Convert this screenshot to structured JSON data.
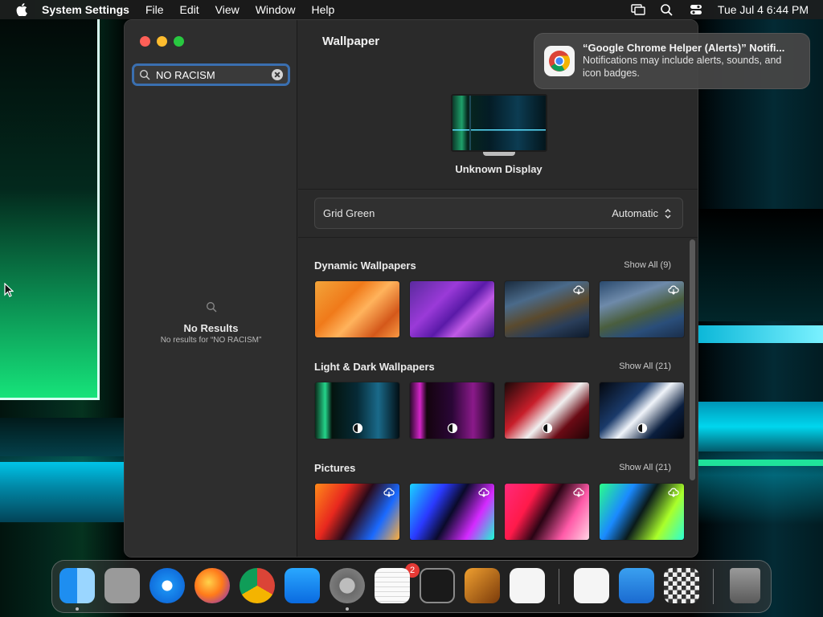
{
  "menubar": {
    "app_name": "System Settings",
    "items": [
      "File",
      "Edit",
      "View",
      "Window",
      "Help"
    ],
    "clock": "Tue Jul 4  6:44 PM"
  },
  "sidebar": {
    "search_value": "NO RACISM",
    "no_results_title": "No Results",
    "no_results_sub": "No results for “NO RACISM”"
  },
  "main": {
    "title": "Wallpaper",
    "display_name": "Unknown Display",
    "wallpaper_name": "Grid Green",
    "wallpaper_mode": "Automatic",
    "sections": [
      {
        "title": "Dynamic Wallpapers",
        "show_all": "Show All (9)"
      },
      {
        "title": "Light & Dark Wallpapers",
        "show_all": "Show All (21)"
      },
      {
        "title": "Pictures",
        "show_all": "Show All (21)"
      }
    ]
  },
  "notification": {
    "title": "“Google Chrome Helper (Alerts)” Notifi...",
    "text": "Notifications may include alerts, sounds, and icon badges."
  },
  "dock": {
    "items": [
      "finder-icon",
      "launchpad-icon",
      "safari-icon",
      "firefox-icon",
      "chrome-icon",
      "app-store-icon",
      "system-settings-icon",
      "textedit-icon",
      "terminal-icon",
      "garageband-icon",
      "vscode-icon",
      "visual-studio-icon",
      "weather-icon",
      "chess-icon",
      "trash-icon"
    ],
    "settings_badge": "2"
  },
  "colors": {
    "accent": "#3a6fb0",
    "window_bg": "#2a2a2a",
    "sidebar_bg": "#2e2e2e"
  }
}
